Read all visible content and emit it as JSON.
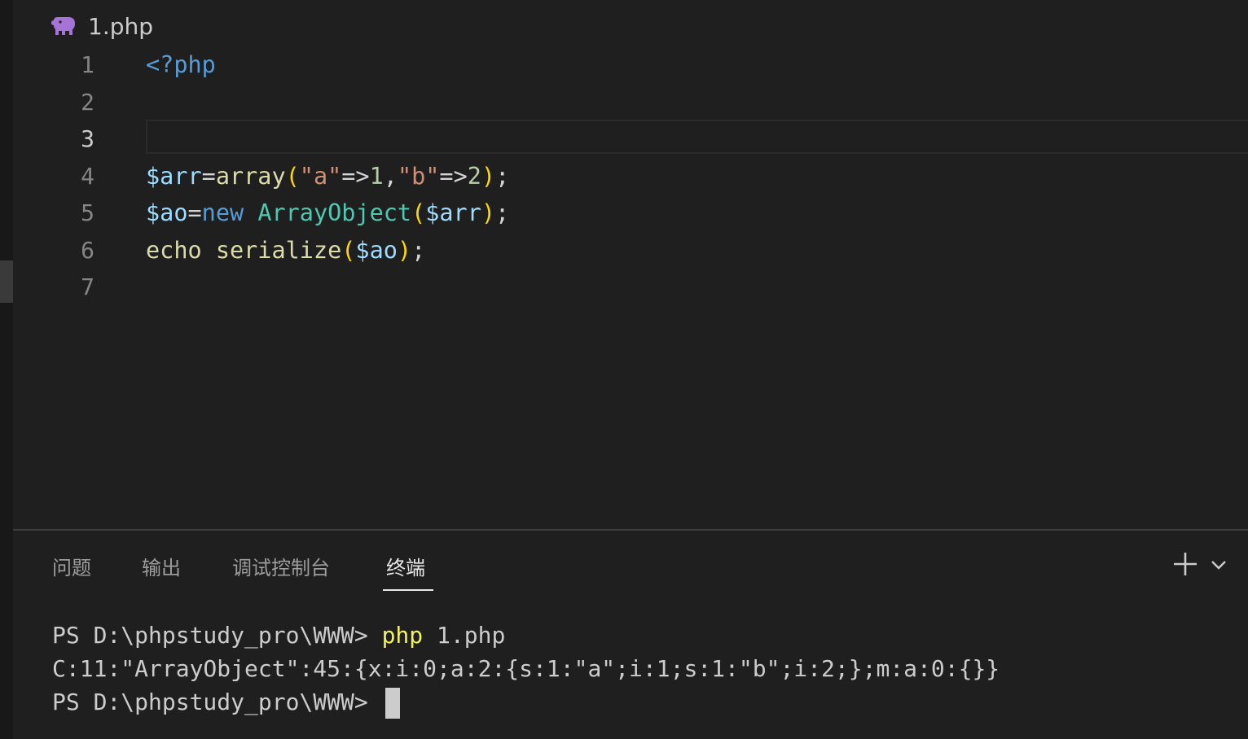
{
  "editor": {
    "file_name": "1.php",
    "file_icon": "php-elephant-icon",
    "current_line": "3",
    "lines": [
      {
        "number": "1",
        "tokens": [
          "<?php"
        ]
      },
      {
        "number": "2",
        "tokens": []
      },
      {
        "number": "3",
        "tokens": []
      },
      {
        "number": "4",
        "tokens": [
          "$arr",
          "=",
          "array",
          "(",
          "\"a\"",
          "=>",
          "1",
          ",",
          "\"b\"",
          "=>",
          "2",
          ")",
          ";"
        ]
      },
      {
        "number": "5",
        "tokens": [
          "$ao",
          "=",
          "new",
          " ",
          "ArrayObject",
          "(",
          "$arr",
          ")",
          ";"
        ]
      },
      {
        "number": "6",
        "tokens": [
          "echo",
          " ",
          "serialize",
          "(",
          "$ao",
          ")",
          ";"
        ]
      },
      {
        "number": "7",
        "tokens": []
      }
    ]
  },
  "panel": {
    "tabs": [
      {
        "label": "问题",
        "active": false
      },
      {
        "label": "输出",
        "active": false
      },
      {
        "label": "调试控制台",
        "active": false
      },
      {
        "label": "终端",
        "active": true
      }
    ],
    "actions": {
      "new_terminal_icon": "plus-icon",
      "dropdown_icon": "chevron-down-icon"
    }
  },
  "terminal": {
    "prompt_1": "PS D:\\phpstudy_pro\\WWW> ",
    "command_1": "php",
    "args_1": " 1.php",
    "output_1": "C:11:\"ArrayObject\":45:{x:i:0;a:2:{s:1:\"a\";i:1;s:1:\"b\";i:2;};m:a:0:{}}",
    "prompt_2": "PS D:\\phpstudy_pro\\WWW> "
  },
  "colors": {
    "background": "#1e1e1e",
    "tag": "#569cd6",
    "variable": "#9cdcfe",
    "function": "#dcdcaa",
    "string": "#ce9178",
    "number": "#b5cea8",
    "class": "#4ec9b0",
    "bracket_1": "#ffd700",
    "bracket_2": "#da70d6",
    "php_icon": "#a674d6",
    "terminal_command": "#f2f25a"
  }
}
